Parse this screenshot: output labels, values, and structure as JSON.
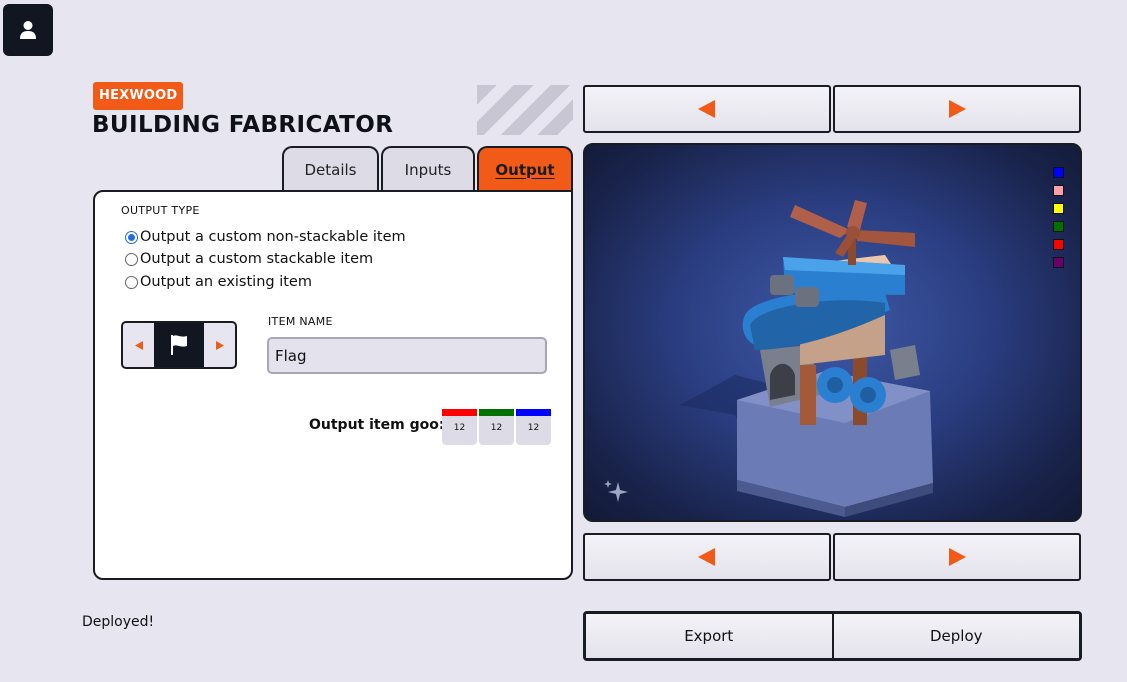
{
  "header": {
    "brand": "HEXWOOD",
    "title": "BUILDING FABRICATOR"
  },
  "tabs": [
    {
      "label": "Details",
      "active": false
    },
    {
      "label": "Inputs",
      "active": false
    },
    {
      "label": "Output",
      "active": true
    }
  ],
  "output": {
    "section_label": "OUTPUT TYPE",
    "options": [
      {
        "label": "Output a custom non-stackable item",
        "selected": true
      },
      {
        "label": "Output a custom stackable item",
        "selected": false
      },
      {
        "label": "Output an existing item",
        "selected": false
      }
    ],
    "icon_picker": {
      "icon": "flag-icon"
    },
    "item_name_label": "ITEM NAME",
    "item_name_value": "Flag",
    "goo_label": "Output item goo:",
    "goo": [
      {
        "color": "#ff0000",
        "value": "12"
      },
      {
        "color": "#007000",
        "value": "12"
      },
      {
        "color": "#0000ff",
        "value": "12"
      }
    ]
  },
  "preview": {
    "color_swatches": [
      "#0000ff",
      "#ffa0a8",
      "#ffff00",
      "#007000",
      "#ff0000",
      "#6a006a"
    ],
    "accent": "#f15a17"
  },
  "status": {
    "text": "Deployed!"
  },
  "actions": {
    "export_label": "Export",
    "deploy_label": "Deploy"
  }
}
